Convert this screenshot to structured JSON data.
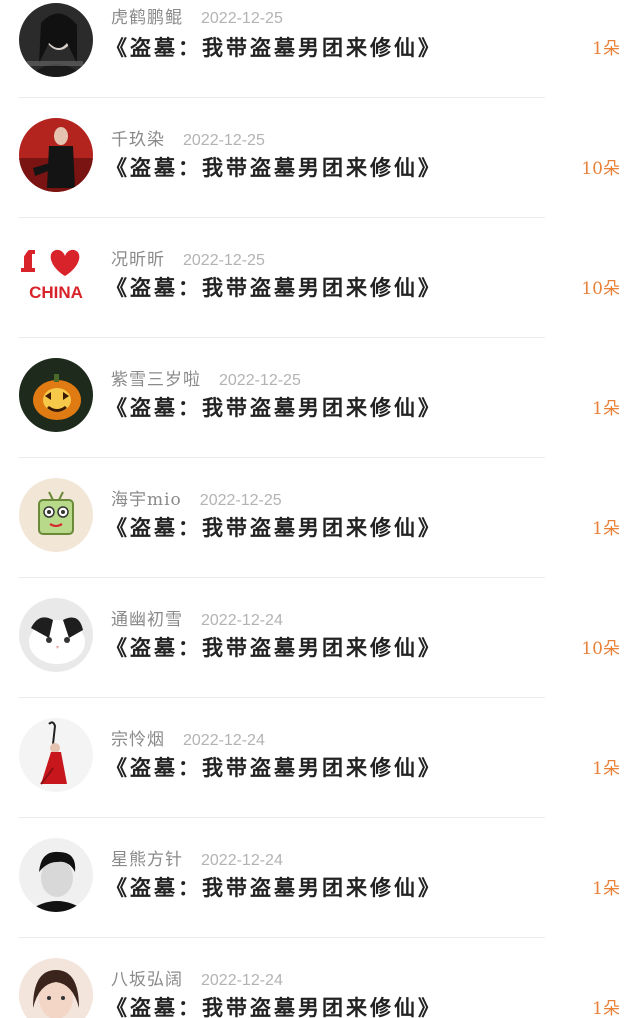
{
  "rows": [
    {
      "name": "虎鹤鹏鲲",
      "date": "2022-12-25",
      "title": "《盗墓：我带盗墓男团来修仙》",
      "amount": "1朵",
      "avatar_icon": "avatar-woman-dark-photo"
    },
    {
      "name": "千玖染",
      "date": "2022-12-25",
      "title": "《盗墓：我带盗墓男团来修仙》",
      "amount": "10朵",
      "avatar_icon": "avatar-woman-red-photo"
    },
    {
      "name": "况昕昕",
      "date": "2022-12-25",
      "title": "《盗墓：我带盗墓男团来修仙》",
      "amount": "10朵",
      "avatar_icon": "avatar-i-love-china",
      "avatar_text": "CHINA"
    },
    {
      "name": "紫雪三岁啦",
      "date": "2022-12-25",
      "title": "《盗墓：我带盗墓男团来修仙》",
      "amount": "1朵",
      "avatar_icon": "avatar-pumpkin"
    },
    {
      "name": "海宇mio",
      "date": "2022-12-25",
      "title": "《盗墓：我带盗墓男团来修仙》",
      "amount": "1朵",
      "avatar_icon": "avatar-cartoon-frog"
    },
    {
      "name": "通幽初雪",
      "date": "2022-12-24",
      "title": "《盗墓：我带盗墓男团来修仙》",
      "amount": "10朵",
      "avatar_icon": "avatar-cat"
    },
    {
      "name": "宗怜烟",
      "date": "2022-12-24",
      "title": "《盗墓：我带盗墓男团来修仙》",
      "amount": "1朵",
      "avatar_icon": "avatar-dancer-red-dress"
    },
    {
      "name": "星熊方针",
      "date": "2022-12-24",
      "title": "《盗墓：我带盗墓男团来修仙》",
      "amount": "1朵",
      "avatar_icon": "avatar-boy-bw"
    },
    {
      "name": "八坂弘阔",
      "date": "2022-12-24",
      "title": "《盗墓：我带盗墓男团来修仙》",
      "amount": "1朵",
      "avatar_icon": "avatar-girl-photo"
    }
  ],
  "colors": {
    "amount": "#e8823a",
    "name": "#8a8a8a",
    "date": "#b3b3b3",
    "title": "#222222",
    "heart": "#d9232a"
  }
}
